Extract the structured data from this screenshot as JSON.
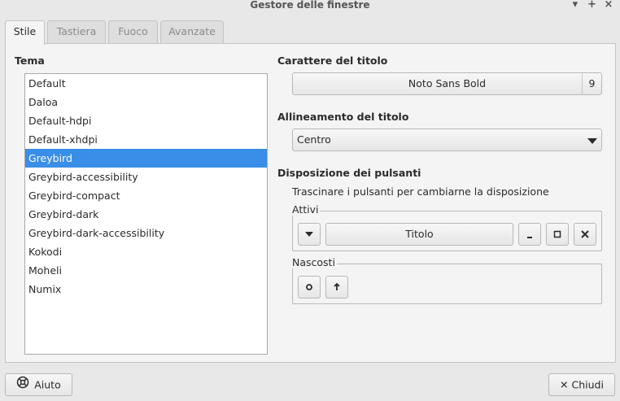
{
  "window": {
    "title": "Gestore delle finestre",
    "controls": [
      "▾",
      "+",
      "×"
    ]
  },
  "tabs": [
    {
      "label": "Stile",
      "active": true
    },
    {
      "label": "Tastiera",
      "active": false
    },
    {
      "label": "Fuoco",
      "active": false
    },
    {
      "label": "Avanzate",
      "active": false
    }
  ],
  "theme": {
    "heading": "Tema",
    "items": [
      "Default",
      "Daloa",
      "Default-hdpi",
      "Default-xhdpi",
      "Greybird",
      "Greybird-accessibility",
      "Greybird-compact",
      "Greybird-dark",
      "Greybird-dark-accessibility",
      "Kokodi",
      "Moheli",
      "Numix"
    ],
    "selected": "Greybird"
  },
  "title_font": {
    "heading": "Carattere del titolo",
    "font": "Noto Sans Bold",
    "size": "9"
  },
  "title_alignment": {
    "heading": "Allineamento del titolo",
    "value": "Centro"
  },
  "button_layout": {
    "heading": "Disposizione dei pulsanti",
    "hint": "Trascinare i pulsanti per cambiarne la disposizione",
    "active_label": "Attivi",
    "title_button": "Titolo",
    "active_icons": [
      "menu-icon",
      "minimize-icon",
      "maximize-icon",
      "close-icon"
    ],
    "hidden_label": "Nascosti",
    "hidden_icons": [
      "stick-icon",
      "shade-icon"
    ]
  },
  "footer": {
    "help": "Aiuto",
    "close": "Chiudi"
  },
  "colors": {
    "selection": "#398ee7",
    "background": "#e8e8e8"
  }
}
